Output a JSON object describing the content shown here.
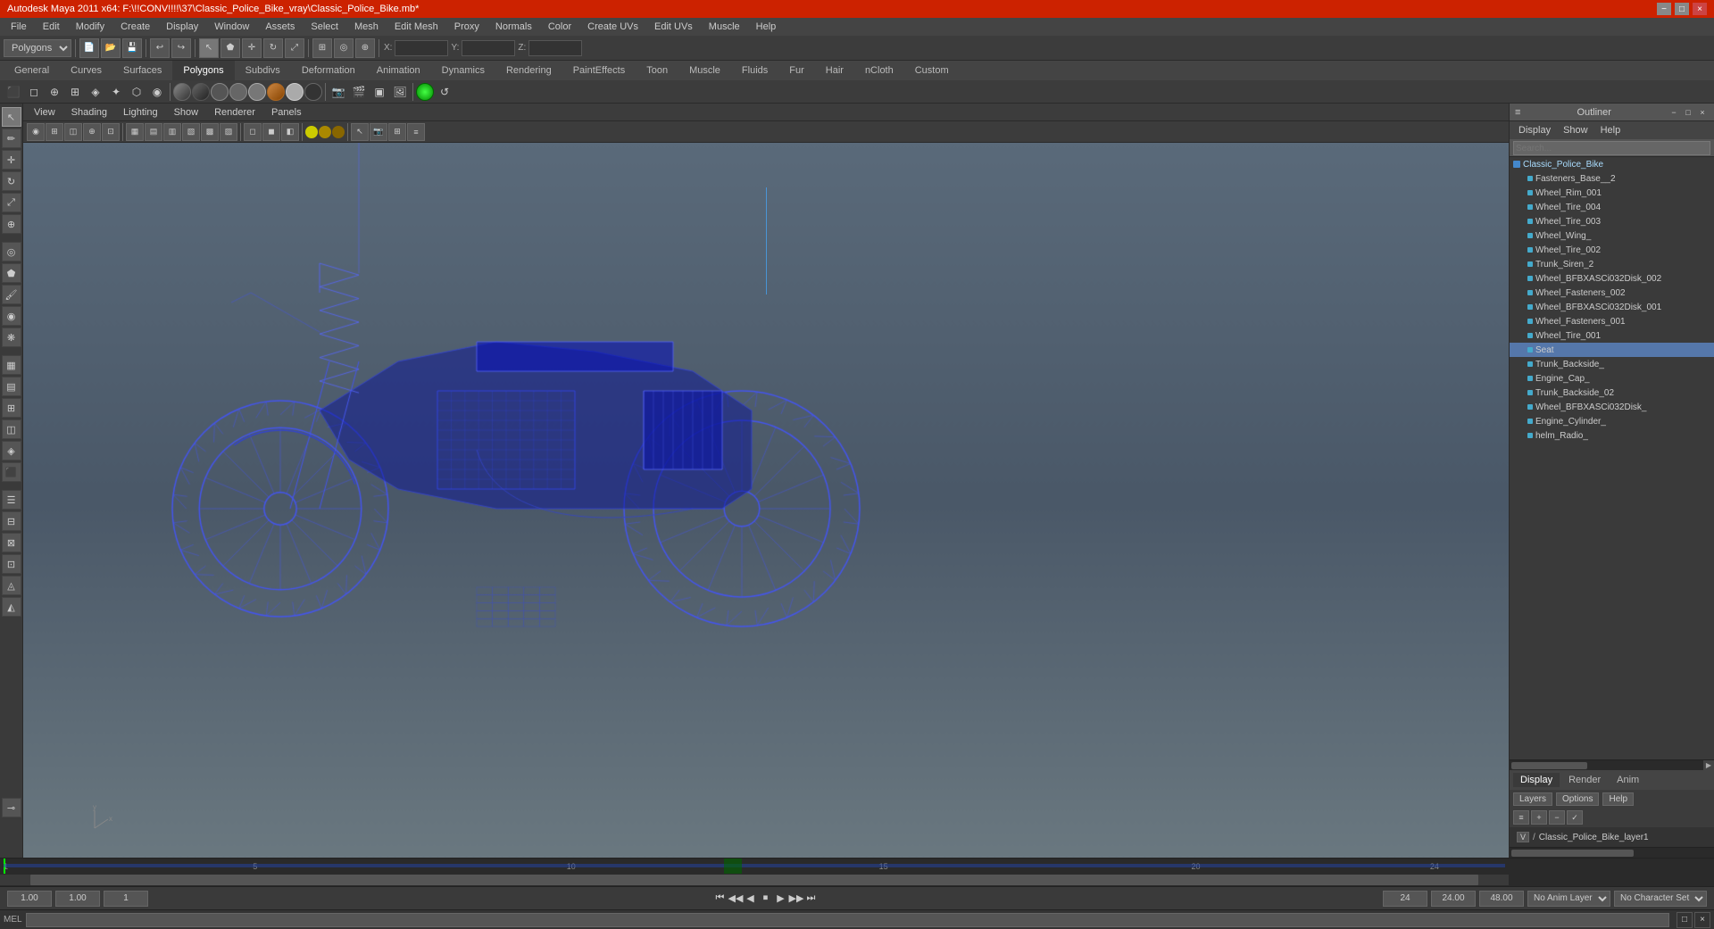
{
  "titlebar": {
    "title": "Autodesk Maya 2011 x64: F:\\!!CONV!!!!\\37\\Classic_Police_Bike_vray\\Classic_Police_Bike.mb*",
    "minimize": "−",
    "maximize": "□",
    "close": "×"
  },
  "menubar": {
    "items": [
      "File",
      "Edit",
      "Modify",
      "Create",
      "Display",
      "Window",
      "Assets",
      "Select",
      "Mesh",
      "Edit Mesh",
      "Proxy",
      "Normals",
      "Color",
      "Create UVs",
      "Edit UVs",
      "Muscle",
      "Help"
    ]
  },
  "toolbar1": {
    "workspace_select": "Polygons",
    "xyz_labels": [
      "X:",
      "Y:",
      "Z:"
    ]
  },
  "tabs": {
    "items": [
      "General",
      "Curves",
      "Surfaces",
      "Polygons",
      "Subdivs",
      "Deformation",
      "Animation",
      "Dynamics",
      "Rendering",
      "PaintEffects",
      "Toon",
      "Muscle",
      "Fluids",
      "Fur",
      "Hair",
      "nCloth",
      "Custom"
    ]
  },
  "viewport": {
    "menu": [
      "View",
      "Shading",
      "Lighting",
      "Show",
      "Renderer",
      "Panels"
    ]
  },
  "outliner": {
    "title": "Outliner",
    "menu": [
      "Display",
      "Show",
      "Help"
    ],
    "items": [
      {
        "name": "Classic_Police_Bike",
        "level": 0,
        "type": "group"
      },
      {
        "name": "Fasteners_Base__2",
        "level": 1,
        "type": "mesh"
      },
      {
        "name": "Wheel_Rim_001",
        "level": 1,
        "type": "mesh"
      },
      {
        "name": "Wheel_Tire_004",
        "level": 1,
        "type": "mesh"
      },
      {
        "name": "Wheel_Tire_003",
        "level": 1,
        "type": "mesh"
      },
      {
        "name": "Wheel_Wing_",
        "level": 1,
        "type": "mesh"
      },
      {
        "name": "Wheel_Tire_002",
        "level": 1,
        "type": "mesh"
      },
      {
        "name": "Trunk_Siren_2",
        "level": 1,
        "type": "mesh"
      },
      {
        "name": "Wheel_BFBXASCi032Disk_002",
        "level": 1,
        "type": "mesh"
      },
      {
        "name": "Wheel_Fasteners_002",
        "level": 1,
        "type": "mesh"
      },
      {
        "name": "Wheel_BFBXASCi032Disk_001",
        "level": 1,
        "type": "mesh"
      },
      {
        "name": "Wheel_Fasteners_001",
        "level": 1,
        "type": "mesh"
      },
      {
        "name": "Wheel_Tire_001",
        "level": 1,
        "type": "mesh"
      },
      {
        "name": "Seat",
        "level": 1,
        "type": "mesh"
      },
      {
        "name": "Trunk_Backside_",
        "level": 1,
        "type": "mesh"
      },
      {
        "name": "Engine_Cap_",
        "level": 1,
        "type": "mesh"
      },
      {
        "name": "Trunk_Backside_02",
        "level": 1,
        "type": "mesh"
      },
      {
        "name": "Wheel_BFBXASCi032Disk_",
        "level": 1,
        "type": "mesh"
      },
      {
        "name": "Engine_Cylinder_",
        "level": 1,
        "type": "mesh"
      },
      {
        "name": "helm_Radio_",
        "level": 1,
        "type": "mesh"
      }
    ]
  },
  "right_bottom": {
    "tabs": [
      "Display",
      "Render",
      "Anim"
    ],
    "layer_tabs": [
      "Layers",
      "Options",
      "Help"
    ],
    "layer_name": "Classic_Police_Bike_layer1"
  },
  "timeline": {
    "start": "1",
    "end": "24",
    "ticks": [
      "1",
      "",
      "",
      "",
      "5",
      "",
      "",
      "",
      "",
      "10",
      "",
      "",
      "",
      "",
      "15",
      "",
      "",
      "",
      "",
      "20",
      "",
      "",
      "",
      "24"
    ]
  },
  "statusbar": {
    "time_start": "1.00",
    "time_current": "1.00",
    "frame_current": "1",
    "frame_end": "24",
    "time_end": "24.00",
    "anim_end": "48.00",
    "anim_layer": "No Anim Layer",
    "char_set": "No Character Set"
  },
  "melbar": {
    "label": "MEL",
    "status": ""
  },
  "playback_buttons": [
    "⏮",
    "◀◀",
    "◀",
    "⏹",
    "▶",
    "▶▶",
    "⏭"
  ],
  "icons": {
    "move": "↔",
    "rotate": "↻",
    "scale": "⤢",
    "select": "↖",
    "lasso": "⬟",
    "paint": "✏",
    "snap_grid": "⊞",
    "snap_curve": "◎",
    "outliner": "≡"
  }
}
